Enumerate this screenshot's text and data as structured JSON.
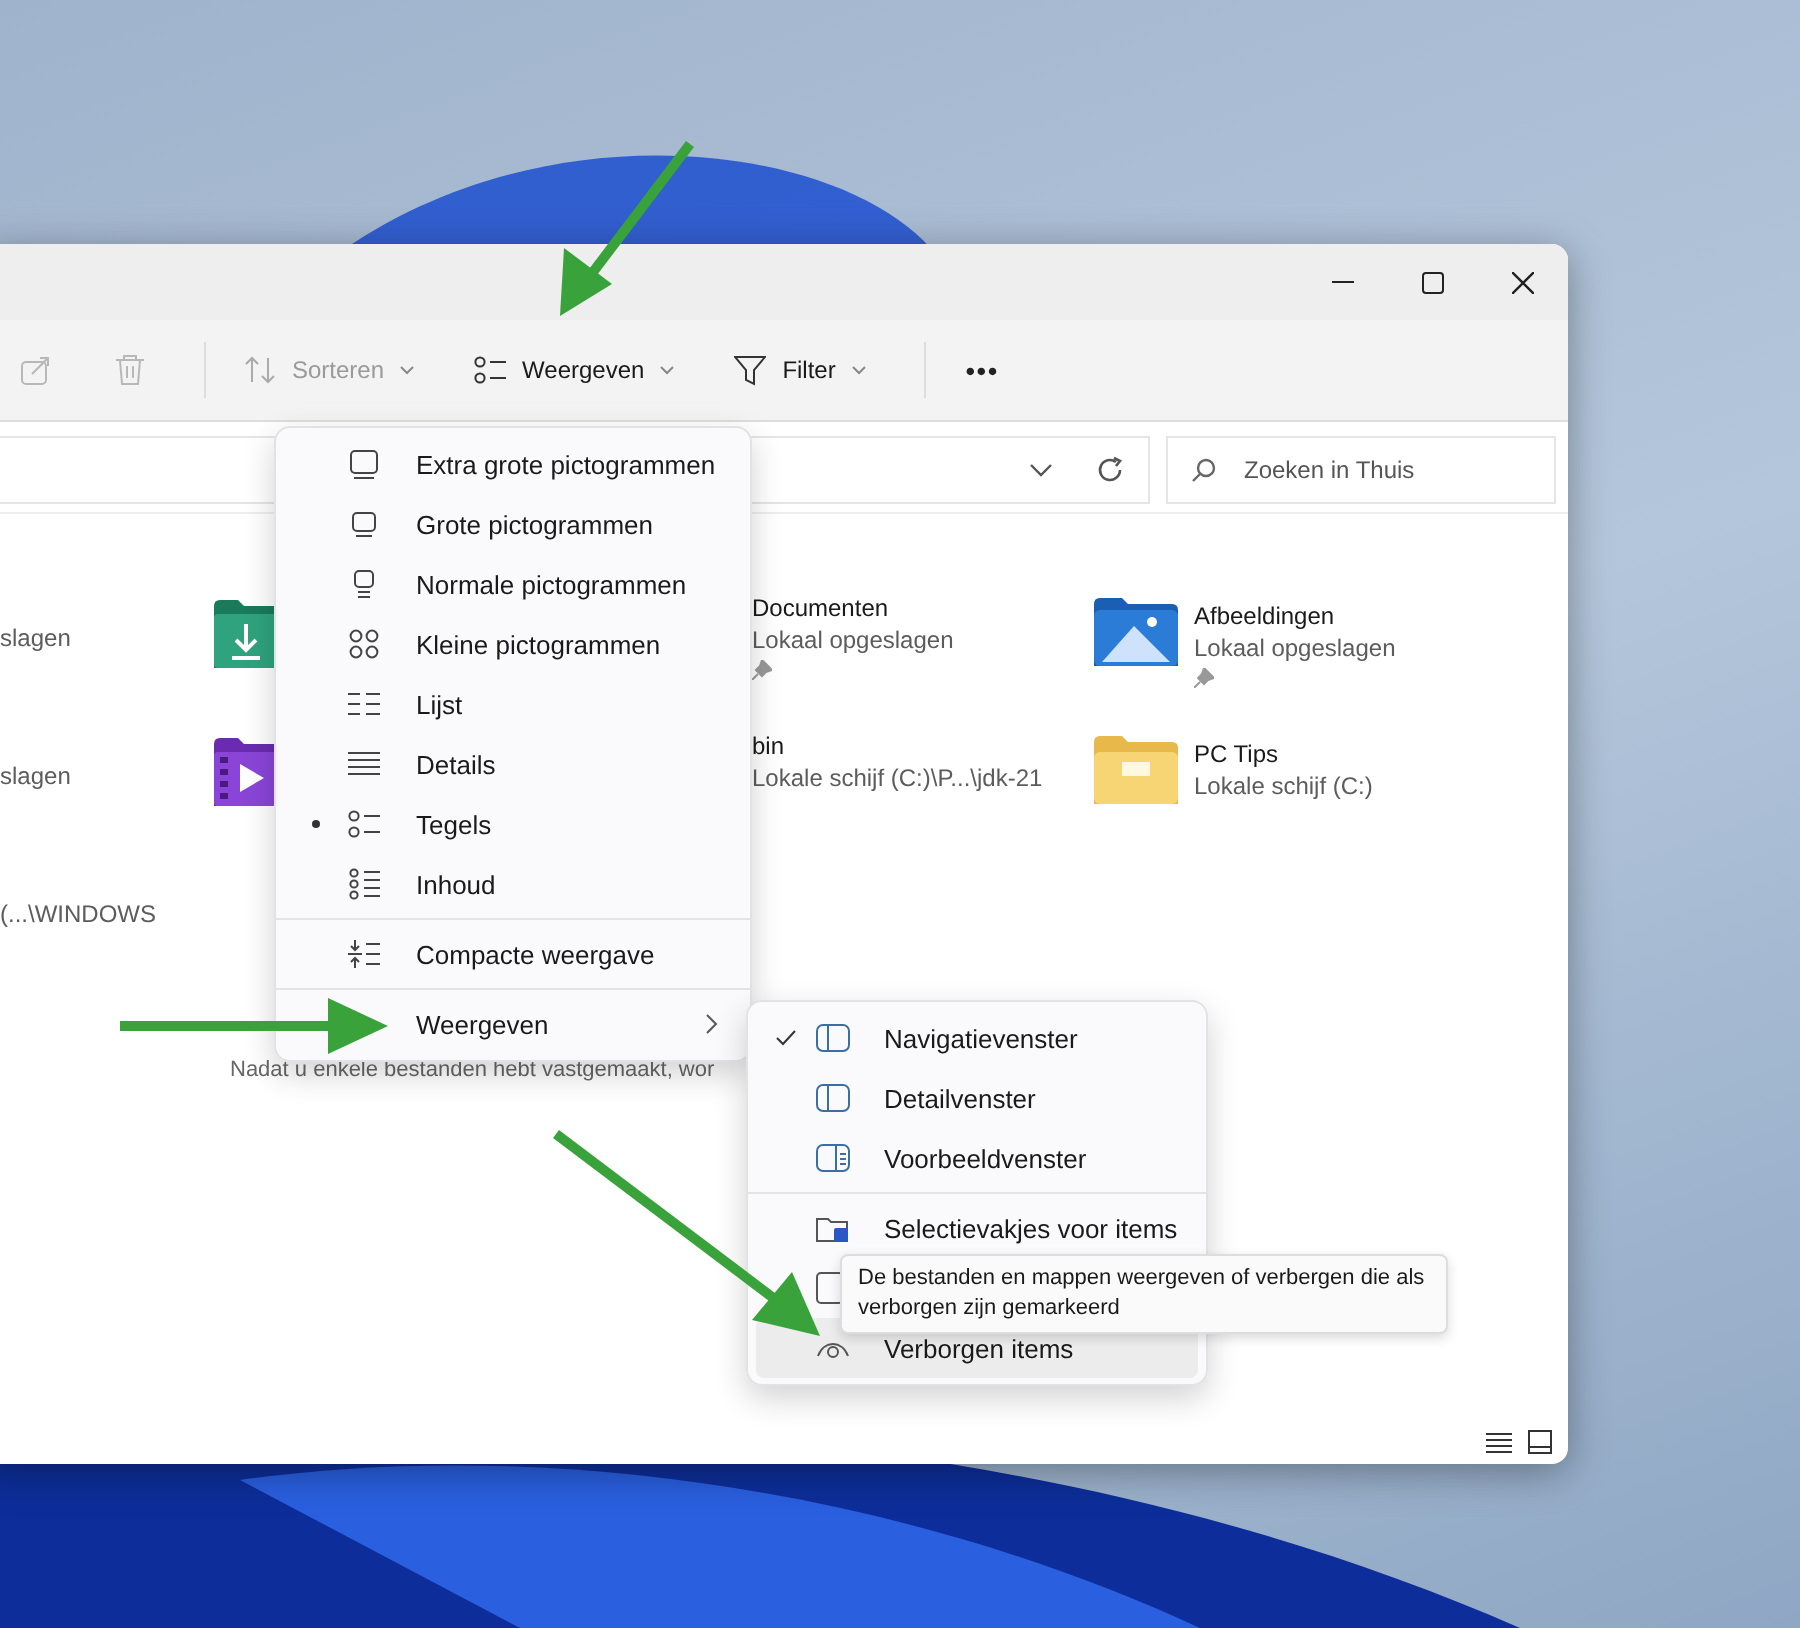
{
  "toolbar": {
    "icon_buttons": [
      {
        "disabled": true
      },
      {
        "disabled": true
      }
    ],
    "buttons": [
      {
        "label": "Sorteren",
        "disabled": true
      },
      {
        "label": "Weergeven",
        "disabled": false
      },
      {
        "label": "Filter",
        "disabled": false
      }
    ],
    "more": "•••"
  },
  "search": {
    "placeholder": "Zoeken in Thuis"
  },
  "tiles": [
    {
      "subtitle": "slagen"
    },
    {
      "name": "Documenten",
      "subtitle": "Lokaal opgeslagen",
      "pinned": true
    },
    {
      "name": "Afbeeldingen",
      "subtitle": "Lokaal opgeslagen",
      "pinned": true
    },
    {
      "subtitle": "slagen"
    },
    {
      "name": "bin",
      "subtitle": "Lokale schijf (C:)\\P...\\jdk-21",
      "pinned": false
    },
    {
      "name": "PC Tips",
      "subtitle": "Lokale schijf (C:)",
      "pinned": false
    },
    {
      "subtitle": "(...\\WINDOWS"
    }
  ],
  "hint": "Nadat u enkele bestanden hebt vastgemaakt, wor",
  "view_menu": [
    {
      "kind": "item",
      "label": "Extra grote pictogrammen",
      "selected": false
    },
    {
      "kind": "item",
      "label": "Grote pictogrammen",
      "selected": false
    },
    {
      "kind": "item",
      "label": "Normale pictogrammen",
      "selected": false
    },
    {
      "kind": "item",
      "label": "Kleine pictogrammen",
      "selected": false
    },
    {
      "kind": "item",
      "label": "Lijst",
      "selected": false
    },
    {
      "kind": "item",
      "label": "Details",
      "selected": false
    },
    {
      "kind": "item",
      "label": "Tegels",
      "selected": true
    },
    {
      "kind": "item",
      "label": "Inhoud",
      "selected": false
    },
    {
      "kind": "divider"
    },
    {
      "kind": "item",
      "label": "Compacte weergave",
      "selected": false
    },
    {
      "kind": "divider"
    },
    {
      "kind": "submenu",
      "label": "Weergeven"
    }
  ],
  "show_menu": [
    {
      "kind": "item",
      "label": "Navigatievenster",
      "checked": true,
      "hovered": false
    },
    {
      "kind": "item",
      "label": "Detailvenster",
      "checked": false,
      "hovered": false
    },
    {
      "kind": "item",
      "label": "Voorbeeldvenster",
      "checked": false,
      "hovered": false
    },
    {
      "kind": "divider"
    },
    {
      "kind": "item",
      "label": "Selectievakjes voor items",
      "checked": false,
      "hovered": false
    },
    {
      "kind": "item",
      "checked": false,
      "hovered": false
    },
    {
      "kind": "item",
      "label": "Verborgen items",
      "checked": false,
      "hovered": true
    }
  ],
  "tooltip": "De bestanden en mappen weergeven of verbergen die als verborgen zijn gemarkeerd"
}
